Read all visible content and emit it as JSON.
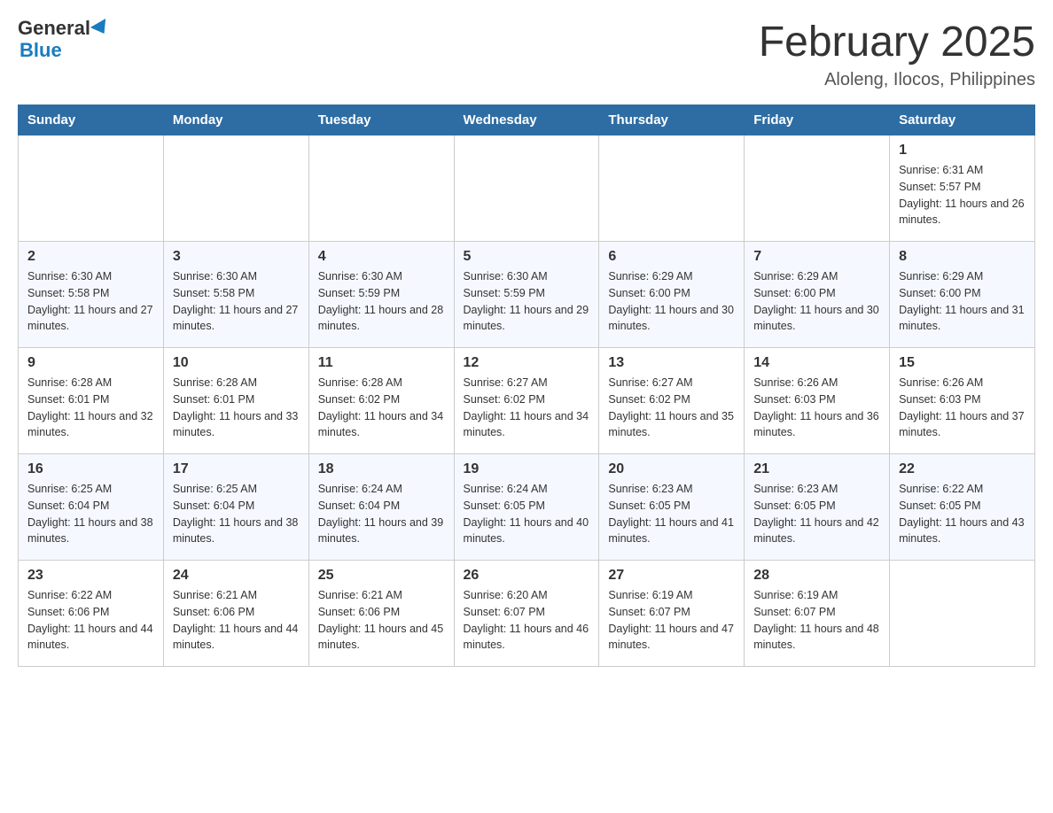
{
  "header": {
    "logo_line1": "General",
    "logo_line2": "Blue",
    "title": "February 2025",
    "subtitle": "Aloleng, Ilocos, Philippines"
  },
  "weekdays": [
    "Sunday",
    "Monday",
    "Tuesday",
    "Wednesday",
    "Thursday",
    "Friday",
    "Saturday"
  ],
  "weeks": [
    [
      {
        "day": "",
        "info": ""
      },
      {
        "day": "",
        "info": ""
      },
      {
        "day": "",
        "info": ""
      },
      {
        "day": "",
        "info": ""
      },
      {
        "day": "",
        "info": ""
      },
      {
        "day": "",
        "info": ""
      },
      {
        "day": "1",
        "info": "Sunrise: 6:31 AM\nSunset: 5:57 PM\nDaylight: 11 hours and 26 minutes."
      }
    ],
    [
      {
        "day": "2",
        "info": "Sunrise: 6:30 AM\nSunset: 5:58 PM\nDaylight: 11 hours and 27 minutes."
      },
      {
        "day": "3",
        "info": "Sunrise: 6:30 AM\nSunset: 5:58 PM\nDaylight: 11 hours and 27 minutes."
      },
      {
        "day": "4",
        "info": "Sunrise: 6:30 AM\nSunset: 5:59 PM\nDaylight: 11 hours and 28 minutes."
      },
      {
        "day": "5",
        "info": "Sunrise: 6:30 AM\nSunset: 5:59 PM\nDaylight: 11 hours and 29 minutes."
      },
      {
        "day": "6",
        "info": "Sunrise: 6:29 AM\nSunset: 6:00 PM\nDaylight: 11 hours and 30 minutes."
      },
      {
        "day": "7",
        "info": "Sunrise: 6:29 AM\nSunset: 6:00 PM\nDaylight: 11 hours and 30 minutes."
      },
      {
        "day": "8",
        "info": "Sunrise: 6:29 AM\nSunset: 6:00 PM\nDaylight: 11 hours and 31 minutes."
      }
    ],
    [
      {
        "day": "9",
        "info": "Sunrise: 6:28 AM\nSunset: 6:01 PM\nDaylight: 11 hours and 32 minutes."
      },
      {
        "day": "10",
        "info": "Sunrise: 6:28 AM\nSunset: 6:01 PM\nDaylight: 11 hours and 33 minutes."
      },
      {
        "day": "11",
        "info": "Sunrise: 6:28 AM\nSunset: 6:02 PM\nDaylight: 11 hours and 34 minutes."
      },
      {
        "day": "12",
        "info": "Sunrise: 6:27 AM\nSunset: 6:02 PM\nDaylight: 11 hours and 34 minutes."
      },
      {
        "day": "13",
        "info": "Sunrise: 6:27 AM\nSunset: 6:02 PM\nDaylight: 11 hours and 35 minutes."
      },
      {
        "day": "14",
        "info": "Sunrise: 6:26 AM\nSunset: 6:03 PM\nDaylight: 11 hours and 36 minutes."
      },
      {
        "day": "15",
        "info": "Sunrise: 6:26 AM\nSunset: 6:03 PM\nDaylight: 11 hours and 37 minutes."
      }
    ],
    [
      {
        "day": "16",
        "info": "Sunrise: 6:25 AM\nSunset: 6:04 PM\nDaylight: 11 hours and 38 minutes."
      },
      {
        "day": "17",
        "info": "Sunrise: 6:25 AM\nSunset: 6:04 PM\nDaylight: 11 hours and 38 minutes."
      },
      {
        "day": "18",
        "info": "Sunrise: 6:24 AM\nSunset: 6:04 PM\nDaylight: 11 hours and 39 minutes."
      },
      {
        "day": "19",
        "info": "Sunrise: 6:24 AM\nSunset: 6:05 PM\nDaylight: 11 hours and 40 minutes."
      },
      {
        "day": "20",
        "info": "Sunrise: 6:23 AM\nSunset: 6:05 PM\nDaylight: 11 hours and 41 minutes."
      },
      {
        "day": "21",
        "info": "Sunrise: 6:23 AM\nSunset: 6:05 PM\nDaylight: 11 hours and 42 minutes."
      },
      {
        "day": "22",
        "info": "Sunrise: 6:22 AM\nSunset: 6:05 PM\nDaylight: 11 hours and 43 minutes."
      }
    ],
    [
      {
        "day": "23",
        "info": "Sunrise: 6:22 AM\nSunset: 6:06 PM\nDaylight: 11 hours and 44 minutes."
      },
      {
        "day": "24",
        "info": "Sunrise: 6:21 AM\nSunset: 6:06 PM\nDaylight: 11 hours and 44 minutes."
      },
      {
        "day": "25",
        "info": "Sunrise: 6:21 AM\nSunset: 6:06 PM\nDaylight: 11 hours and 45 minutes."
      },
      {
        "day": "26",
        "info": "Sunrise: 6:20 AM\nSunset: 6:07 PM\nDaylight: 11 hours and 46 minutes."
      },
      {
        "day": "27",
        "info": "Sunrise: 6:19 AM\nSunset: 6:07 PM\nDaylight: 11 hours and 47 minutes."
      },
      {
        "day": "28",
        "info": "Sunrise: 6:19 AM\nSunset: 6:07 PM\nDaylight: 11 hours and 48 minutes."
      },
      {
        "day": "",
        "info": ""
      }
    ]
  ]
}
